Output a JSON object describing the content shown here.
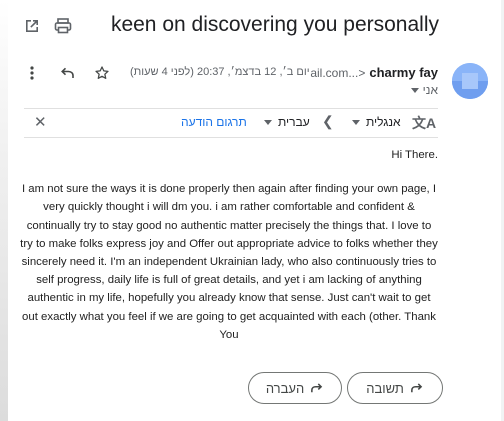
{
  "subject": "keen on discovering you personally",
  "toolbar": {
    "popout_icon": "open-in-new-window-icon",
    "print_icon": "print-icon"
  },
  "sender": {
    "name": "charmy fay",
    "email": "<...ail.com",
    "to_label": "אני",
    "date": "יום ב׳, 12 בדצמ׳, 20:37 (לפני 4 שעות)"
  },
  "translate": {
    "from_lang": "אנגלית",
    "to_lang": "עברית",
    "translate_link": "תרגום הודעה"
  },
  "message": {
    "greeting": ".Hi There",
    "paragraph": "I am not sure the ways it is done properly then again after finding your own page, I very quickly thought i will dm you. i am rather comfortable and confident & continually try to stay good no authentic matter precisely the things that. I love to try to make folks express joy and Offer out appropriate advice to folks whether they sincerely need it. I'm an independent Ukrainian lady, who also continuously tries to self progress, daily life is full of great details, and yet i am lacking of anything authentic in my life, hopefully you already know that sense. Just can't wait to get out exactly what you feel if we are going to get acquainted with each (other. Thank You"
  },
  "actions": {
    "reply_label": "תשובה",
    "forward_label": "העברה"
  },
  "colors": {
    "link": "#1a73e8",
    "avatar": "#8ab4f8"
  }
}
